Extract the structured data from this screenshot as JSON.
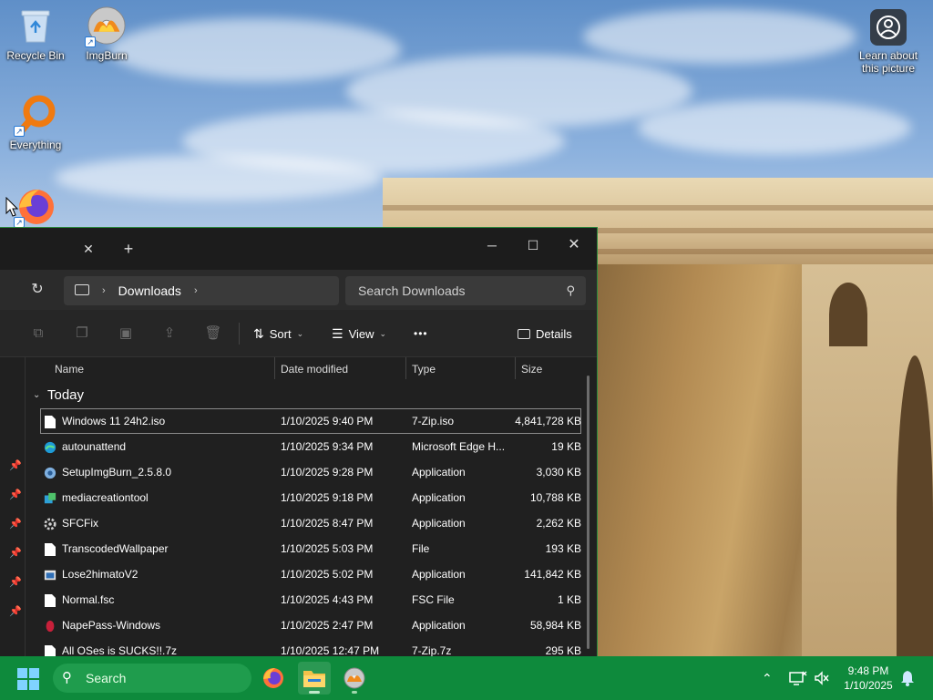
{
  "desktop": {
    "icons": [
      {
        "label": "Recycle Bin"
      },
      {
        "label": "ImgBurn"
      },
      {
        "label": "Everything"
      }
    ],
    "learn_label_1": "Learn about",
    "learn_label_2": "this picture"
  },
  "explorer": {
    "address": {
      "location": "Downloads"
    },
    "search": {
      "placeholder": "Search Downloads"
    },
    "toolbar": {
      "sort_label": "Sort",
      "view_label": "View",
      "more_label": "•••",
      "details_label": "Details"
    },
    "columns": {
      "name": "Name",
      "date": "Date modified",
      "type": "Type",
      "size": "Size"
    },
    "group_label": "Today",
    "files": [
      {
        "name": "Windows 11 24h2.iso",
        "date": "1/10/2025 9:40 PM",
        "type": "7-Zip.iso",
        "size": "4,841,728 KB",
        "icon": "file-icon"
      },
      {
        "name": "autounattend",
        "date": "1/10/2025 9:34 PM",
        "type": "Microsoft Edge H...",
        "size": "19 KB",
        "icon": "edge-icon"
      },
      {
        "name": "SetupImgBurn_2.5.8.0",
        "date": "1/10/2025 9:28 PM",
        "type": "Application",
        "size": "3,030 KB",
        "icon": "setup-icon"
      },
      {
        "name": "mediacreationtool",
        "date": "1/10/2025 9:18 PM",
        "type": "Application",
        "size": "10,788 KB",
        "icon": "media-tool-icon"
      },
      {
        "name": "SFCFix",
        "date": "1/10/2025 8:47 PM",
        "type": "Application",
        "size": "2,262 KB",
        "icon": "sfcfix-icon"
      },
      {
        "name": "TranscodedWallpaper",
        "date": "1/10/2025 5:03 PM",
        "type": "File",
        "size": "193 KB",
        "icon": "file-icon"
      },
      {
        "name": "Lose2himatoV2",
        "date": "1/10/2025 5:02 PM",
        "type": "Application",
        "size": "141,842 KB",
        "icon": "app-window-icon"
      },
      {
        "name": "Normal.fsc",
        "date": "1/10/2025 4:43 PM",
        "type": "FSC File",
        "size": "1 KB",
        "icon": "file-icon"
      },
      {
        "name": "NapePass-Windows",
        "date": "1/10/2025 2:47 PM",
        "type": "Application",
        "size": "58,984 KB",
        "icon": "napepass-icon"
      },
      {
        "name": "All OSes is SUCKS!!.7z",
        "date": "1/10/2025 12:47 PM",
        "type": "7-Zip.7z",
        "size": "295 KB",
        "icon": "file-icon"
      }
    ]
  },
  "taskbar": {
    "search_label": "Search",
    "time": "9:48 PM",
    "date": "1/10/2025"
  },
  "colors": {
    "taskbar": "#0e8a3c",
    "explorer_bg": "#202020",
    "accent_border": "#2a8a3c"
  }
}
